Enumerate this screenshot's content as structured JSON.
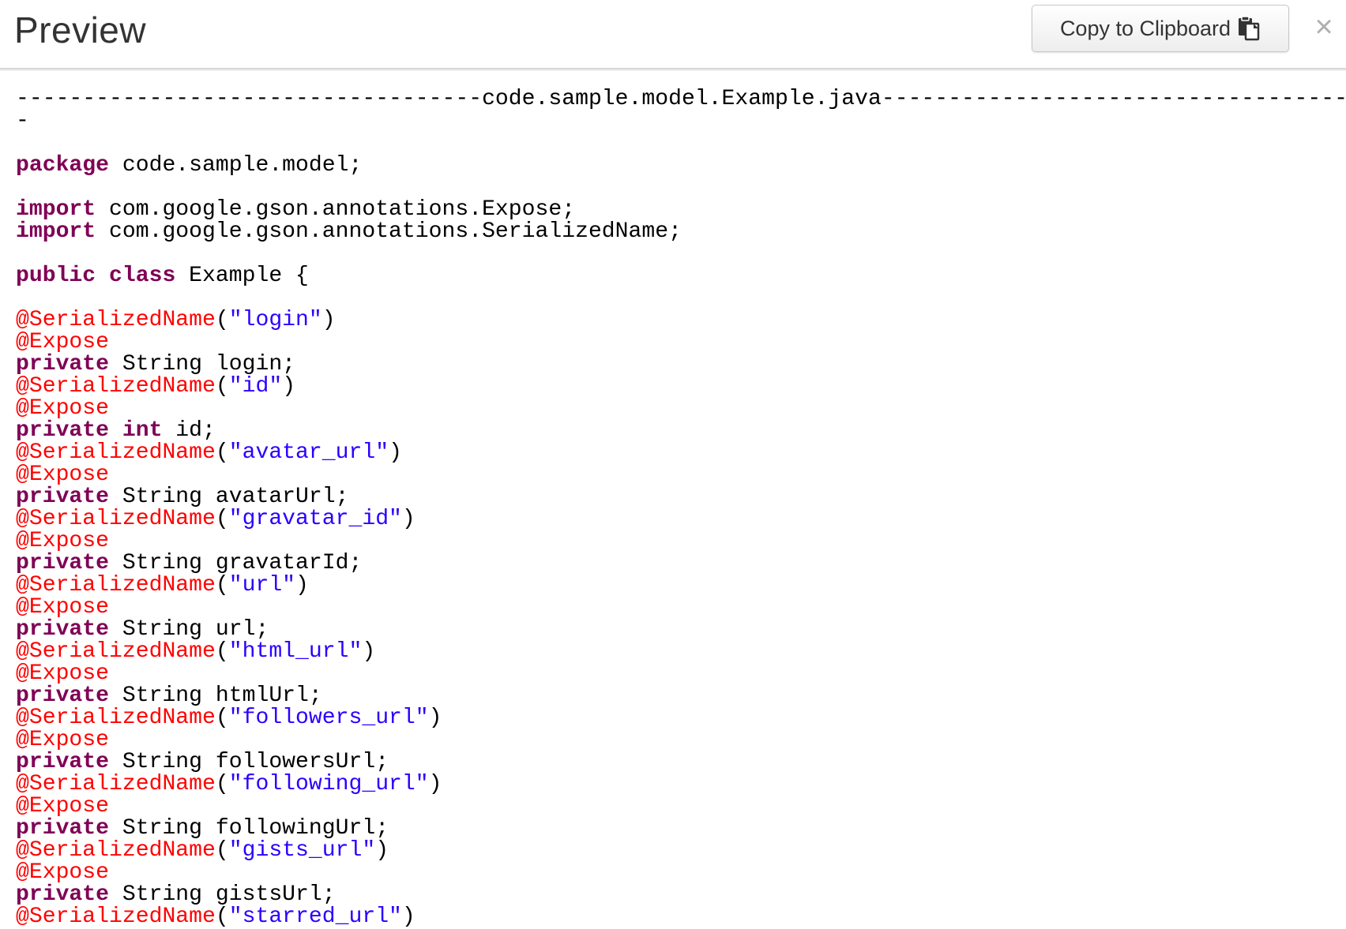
{
  "header": {
    "title": "Preview",
    "copy_button_label": "Copy to Clipboard",
    "copy_icon": "clipboard-icon",
    "close_glyph": "×",
    "close_icon": "close-icon"
  },
  "colors": {
    "keyword": "#7f0055",
    "annotation": "#ff0000",
    "string": "#2a00ff",
    "plain": "#000000"
  },
  "code": {
    "lines": [
      [
        {
          "t": "-----------------------------------",
          "c": "plain"
        },
        {
          "t": "code.sample.model.Example.java",
          "c": "plain"
        },
        {
          "t": "-----------------------------------",
          "c": "plain"
        }
      ],
      [
        {
          "t": "-",
          "c": "plain"
        }
      ],
      [],
      [
        {
          "t": "package",
          "c": "kw"
        },
        {
          "t": " code.sample.model;",
          "c": "plain"
        }
      ],
      [],
      [
        {
          "t": "import",
          "c": "kw"
        },
        {
          "t": " com.google.gson.annotations.Expose;",
          "c": "plain"
        }
      ],
      [
        {
          "t": "import",
          "c": "kw"
        },
        {
          "t": " com.google.gson.annotations.SerializedName;",
          "c": "plain"
        }
      ],
      [],
      [
        {
          "t": "public",
          "c": "kw"
        },
        {
          "t": " ",
          "c": "plain"
        },
        {
          "t": "class",
          "c": "kw"
        },
        {
          "t": " Example {",
          "c": "plain"
        }
      ],
      [],
      [
        {
          "t": "@SerializedName",
          "c": "ann"
        },
        {
          "t": "(",
          "c": "plain"
        },
        {
          "t": "\"login\"",
          "c": "str"
        },
        {
          "t": ")",
          "c": "plain"
        }
      ],
      [
        {
          "t": "@Expose",
          "c": "ann"
        }
      ],
      [
        {
          "t": "private",
          "c": "kw"
        },
        {
          "t": " String login;",
          "c": "plain"
        }
      ],
      [
        {
          "t": "@SerializedName",
          "c": "ann"
        },
        {
          "t": "(",
          "c": "plain"
        },
        {
          "t": "\"id\"",
          "c": "str"
        },
        {
          "t": ")",
          "c": "plain"
        }
      ],
      [
        {
          "t": "@Expose",
          "c": "ann"
        }
      ],
      [
        {
          "t": "private",
          "c": "kw"
        },
        {
          "t": " ",
          "c": "plain"
        },
        {
          "t": "int",
          "c": "kw"
        },
        {
          "t": " id;",
          "c": "plain"
        }
      ],
      [
        {
          "t": "@SerializedName",
          "c": "ann"
        },
        {
          "t": "(",
          "c": "plain"
        },
        {
          "t": "\"avatar_url\"",
          "c": "str"
        },
        {
          "t": ")",
          "c": "plain"
        }
      ],
      [
        {
          "t": "@Expose",
          "c": "ann"
        }
      ],
      [
        {
          "t": "private",
          "c": "kw"
        },
        {
          "t": " String avatarUrl;",
          "c": "plain"
        }
      ],
      [
        {
          "t": "@SerializedName",
          "c": "ann"
        },
        {
          "t": "(",
          "c": "plain"
        },
        {
          "t": "\"gravatar_id\"",
          "c": "str"
        },
        {
          "t": ")",
          "c": "plain"
        }
      ],
      [
        {
          "t": "@Expose",
          "c": "ann"
        }
      ],
      [
        {
          "t": "private",
          "c": "kw"
        },
        {
          "t": " String gravatarId;",
          "c": "plain"
        }
      ],
      [
        {
          "t": "@SerializedName",
          "c": "ann"
        },
        {
          "t": "(",
          "c": "plain"
        },
        {
          "t": "\"url\"",
          "c": "str"
        },
        {
          "t": ")",
          "c": "plain"
        }
      ],
      [
        {
          "t": "@Expose",
          "c": "ann"
        }
      ],
      [
        {
          "t": "private",
          "c": "kw"
        },
        {
          "t": " String url;",
          "c": "plain"
        }
      ],
      [
        {
          "t": "@SerializedName",
          "c": "ann"
        },
        {
          "t": "(",
          "c": "plain"
        },
        {
          "t": "\"html_url\"",
          "c": "str"
        },
        {
          "t": ")",
          "c": "plain"
        }
      ],
      [
        {
          "t": "@Expose",
          "c": "ann"
        }
      ],
      [
        {
          "t": "private",
          "c": "kw"
        },
        {
          "t": " String htmlUrl;",
          "c": "plain"
        }
      ],
      [
        {
          "t": "@SerializedName",
          "c": "ann"
        },
        {
          "t": "(",
          "c": "plain"
        },
        {
          "t": "\"followers_url\"",
          "c": "str"
        },
        {
          "t": ")",
          "c": "plain"
        }
      ],
      [
        {
          "t": "@Expose",
          "c": "ann"
        }
      ],
      [
        {
          "t": "private",
          "c": "kw"
        },
        {
          "t": " String followersUrl;",
          "c": "plain"
        }
      ],
      [
        {
          "t": "@SerializedName",
          "c": "ann"
        },
        {
          "t": "(",
          "c": "plain"
        },
        {
          "t": "\"following_url\"",
          "c": "str"
        },
        {
          "t": ")",
          "c": "plain"
        }
      ],
      [
        {
          "t": "@Expose",
          "c": "ann"
        }
      ],
      [
        {
          "t": "private",
          "c": "kw"
        },
        {
          "t": " String followingUrl;",
          "c": "plain"
        }
      ],
      [
        {
          "t": "@SerializedName",
          "c": "ann"
        },
        {
          "t": "(",
          "c": "plain"
        },
        {
          "t": "\"gists_url\"",
          "c": "str"
        },
        {
          "t": ")",
          "c": "plain"
        }
      ],
      [
        {
          "t": "@Expose",
          "c": "ann"
        }
      ],
      [
        {
          "t": "private",
          "c": "kw"
        },
        {
          "t": " String gistsUrl;",
          "c": "plain"
        }
      ],
      [
        {
          "t": "@SerializedName",
          "c": "ann"
        },
        {
          "t": "(",
          "c": "plain"
        },
        {
          "t": "\"starred_url\"",
          "c": "str"
        },
        {
          "t": ")",
          "c": "plain"
        }
      ]
    ]
  }
}
